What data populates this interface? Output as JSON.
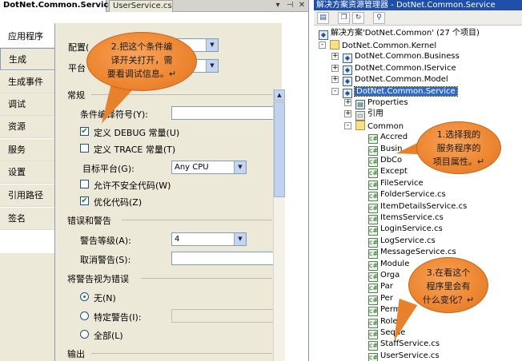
{
  "document_tabs": {
    "active": "DotNet.Common.Service*",
    "inactive": "UserService.cs",
    "menu_arrow": "▾",
    "pin": "⊣",
    "close": "✕"
  },
  "sidebar": {
    "items": [
      {
        "label": "应用程序"
      },
      {
        "label": "生成"
      },
      {
        "label": "生成事件"
      },
      {
        "label": "调试"
      },
      {
        "label": "资源"
      },
      {
        "label": "服务"
      },
      {
        "label": "设置"
      },
      {
        "label": "引用路径"
      },
      {
        "label": "签名"
      }
    ]
  },
  "config_bar": {
    "config_label": "配置(",
    "platform_label": "平台"
  },
  "general": {
    "title": "常规",
    "conditional_symbols_label": "条件编译符号(Y):",
    "define_debug_label": "定义 DEBUG 常量(U)",
    "define_debug_checked": true,
    "define_trace_label": "定义 TRACE 常量(T)",
    "define_trace_checked": false,
    "target_platform_label": "目标平台(G):",
    "target_platform_value": "Any CPU",
    "allow_unsafe_label": "允许不安全代码(W)",
    "allow_unsafe_checked": false,
    "optimize_label": "优化代码(Z)",
    "optimize_checked": true,
    "check_glyph": "✔"
  },
  "errors_warnings": {
    "title": "错误和警告",
    "warning_level_label": "警告等级(A):",
    "warning_level_value": "4",
    "suppress_label": "取消警告(S):"
  },
  "treat_warnings": {
    "title": "将警告视为错误",
    "none_label": "无(N)",
    "specific_label": "特定警告(I):",
    "all_label": "全部(L)",
    "selected": "none"
  },
  "output_section": {
    "title": "输出"
  },
  "solution_explorer": {
    "title": "解决方案资源管理器 - DotNet.Common.Service",
    "toolbar": [
      "properties-icon",
      "show-all-files-icon",
      "refresh-icon",
      "class-diagram-icon"
    ],
    "solution_label": "解决方案'DotNet.Common' (27 个项目)",
    "tree": [
      {
        "label": "DotNet.Common.Kernel",
        "indent": 1,
        "expander": "-",
        "icon": "folder"
      },
      {
        "label": "DotNet.Common.Business",
        "indent": 2,
        "expander": "+",
        "icon": "proj"
      },
      {
        "label": "DotNet.Common.IService",
        "indent": 2,
        "expander": "+",
        "icon": "proj"
      },
      {
        "label": "DotNet.Common.Model",
        "indent": 2,
        "expander": "+",
        "icon": "proj"
      },
      {
        "label": "DotNet.Common.Service",
        "indent": 2,
        "expander": "-",
        "icon": "proj",
        "selected": true
      },
      {
        "label": "Properties",
        "indent": 3,
        "expander": "+",
        "icon": "props"
      },
      {
        "label": "引用",
        "indent": 3,
        "expander": "+",
        "icon": "ref"
      },
      {
        "label": "Common",
        "indent": 3,
        "expander": "-",
        "icon": "folder"
      },
      {
        "label": "Accred",
        "indent": 4,
        "icon": "cs"
      },
      {
        "label": "Busin",
        "indent": 4,
        "icon": "cs"
      },
      {
        "label": "DbCo",
        "indent": 4,
        "icon": "cs"
      },
      {
        "label": "Except",
        "indent": 4,
        "icon": "cs"
      },
      {
        "label": "FileService",
        "indent": 4,
        "icon": "cs"
      },
      {
        "label": "FolderService.cs",
        "indent": 4,
        "icon": "cs"
      },
      {
        "label": "ItemDetailsService.cs",
        "indent": 4,
        "icon": "cs"
      },
      {
        "label": "ItemsService.cs",
        "indent": 4,
        "icon": "cs"
      },
      {
        "label": "LoginService.cs",
        "indent": 4,
        "icon": "cs"
      },
      {
        "label": "LogService.cs",
        "indent": 4,
        "icon": "cs"
      },
      {
        "label": "MessageService.cs",
        "indent": 4,
        "icon": "cs"
      },
      {
        "label": "Module",
        "indent": 4,
        "icon": "cs"
      },
      {
        "label": "Orga",
        "indent": 4,
        "icon": "cs"
      },
      {
        "label": "Par",
        "indent": 4,
        "icon": "cs"
      },
      {
        "label": "Per",
        "indent": 4,
        "icon": "cs"
      },
      {
        "label": "Perm",
        "indent": 4,
        "icon": "cs"
      },
      {
        "label": "RoleS",
        "indent": 4,
        "icon": "cs"
      },
      {
        "label": "Seque",
        "indent": 4,
        "icon": "cs"
      },
      {
        "label": "StaffService.cs",
        "indent": 4,
        "icon": "cs"
      },
      {
        "label": "UserService.cs",
        "indent": 4,
        "icon": "cs"
      }
    ]
  },
  "callouts": {
    "left": [
      "2.把这个条件编",
      "译开关打开，需",
      "要看调试信息。↵"
    ],
    "right_top": [
      "1.选择我的",
      "服务程序的",
      "项目属性。↵"
    ],
    "right_bottom": [
      "3.在看这个",
      "程序里会有",
      "什么变化？↵"
    ]
  },
  "colors": {
    "selection": "#316ac5",
    "callout_fill": "#ee8833",
    "panel_bg": "#ece9d8",
    "title_bar": "#1f4fa8"
  }
}
